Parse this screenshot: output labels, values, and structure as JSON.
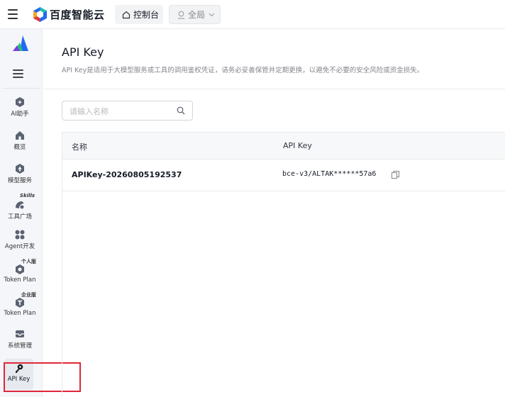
{
  "topbar": {
    "brand": "百度智能云",
    "console_label": "控制台",
    "region_label": "全局"
  },
  "sidebar": {
    "items": [
      {
        "label": "AI助手",
        "icon": "ai-assistant-icon"
      },
      {
        "label": "概览",
        "icon": "home-icon"
      },
      {
        "label": "模型服务",
        "icon": "model-service-icon"
      },
      {
        "label": "工具广场",
        "icon": "tool-plaza-icon",
        "badge": "Skills"
      },
      {
        "label": "Agent开发",
        "icon": "agent-dev-icon"
      },
      {
        "label": "Token Plan",
        "icon": "token-plan-personal-icon",
        "badge": "个人版"
      },
      {
        "label": "Token Plan",
        "icon": "token-plan-enterprise-icon",
        "badge": "企业版"
      },
      {
        "label": "系统管理",
        "icon": "system-manage-icon"
      },
      {
        "label": "API Key",
        "icon": "key-icon",
        "active": true
      }
    ]
  },
  "page": {
    "title": "API Key",
    "description": "API Key是适用于大模型服务或工具的调用鉴权凭证，请务必妥善保管并定期更换，以避免不必要的安全风险或资金损失。"
  },
  "search": {
    "placeholder": "请输入名称",
    "value": ""
  },
  "table": {
    "columns": [
      "名称",
      "API Key"
    ],
    "rows": [
      {
        "name": "APIKey-20260805192537",
        "key": "bce-v3/ALTAK******57a6"
      }
    ]
  },
  "colors": {
    "highlight": "#e0263a",
    "sidebar_bg": "#f4f6f9",
    "brand_blue": "#2468f2"
  }
}
